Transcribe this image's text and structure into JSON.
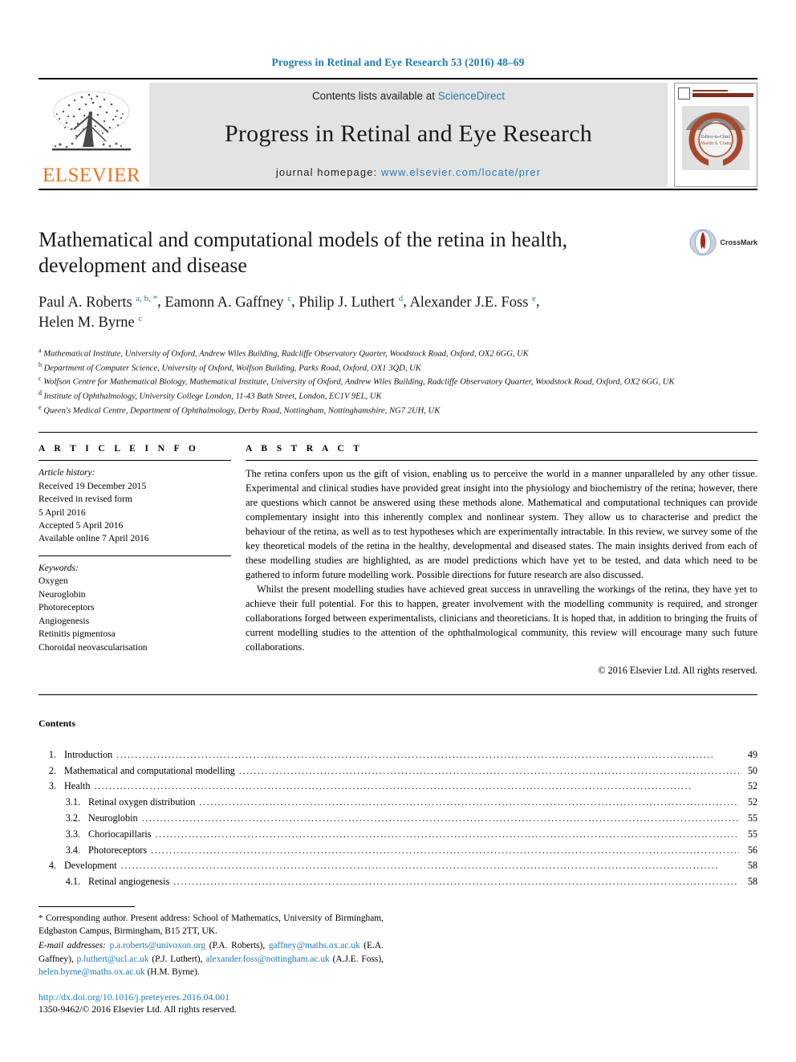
{
  "running_head": "Progress in Retinal and Eye Research 53 (2016) 48–69",
  "masthead": {
    "contents_lists_prefix": "Contents lists available at ",
    "sciencedirect": "ScienceDirect",
    "journal_name": "Progress in Retinal and Eye Research",
    "homepage_prefix": "journal homepage: ",
    "homepage_url": "www.elsevier.com/locate/prer",
    "publisher": "ELSEVIER",
    "publisher_logo_icon": "elsevier-tree-icon",
    "cover_thumb_icon": "journal-cover-eye-icon",
    "cover_title": "PROGRESS IN RETINAL AND EYE RESEARCH",
    "cover_editor_line1": "Editor-in-Chief",
    "cover_editor_line2": "Martin S. Cranz"
  },
  "article": {
    "title": "Mathematical and computational models of the retina in health, development and disease",
    "crossmark_label": "CrossMark",
    "crossmark_icon": "crossmark-icon",
    "authors": [
      {
        "name": "Paul A. Roberts",
        "sup": "a, b, *"
      },
      {
        "name": "Eamonn A. Gaffney",
        "sup": "c"
      },
      {
        "name": "Philip J. Luthert",
        "sup": "d"
      },
      {
        "name": "Alexander J.E. Foss",
        "sup": "e"
      },
      {
        "name": "Helen M. Byrne",
        "sup": "c"
      }
    ],
    "affiliations": [
      {
        "marker": "a",
        "text": "Mathematical Institute, University of Oxford, Andrew Wiles Building, Radcliffe Observatory Quarter, Woodstock Road, Oxford, OX2 6GG, UK"
      },
      {
        "marker": "b",
        "text": "Department of Computer Science, University of Oxford, Wolfson Building, Parks Road, Oxford, OX1 3QD, UK"
      },
      {
        "marker": "c",
        "text": "Wolfson Centre for Mathematical Biology, Mathematical Institute, University of Oxford, Andrew Wiles Building, Radcliffe Observatory Quarter, Woodstock Road, Oxford, OX2 6GG, UK"
      },
      {
        "marker": "d",
        "text": "Institute of Ophthalmology, University College London, 11-43 Bath Street, London, EC1V 9EL, UK"
      },
      {
        "marker": "e",
        "text": "Queen's Medical Centre, Department of Ophthalmology, Derby Road, Nottingham, Nottinghamshire, NG7 2UH, UK"
      }
    ]
  },
  "article_info": {
    "heading": "A R T I C L E  I N F O",
    "history_label": "Article history:",
    "history": [
      "Received 19 December 2015",
      "Received in revised form",
      "5 April 2016",
      "Accepted 5 April 2016",
      "Available online 7 April 2016"
    ],
    "keywords_label": "Keywords:",
    "keywords": [
      "Oxygen",
      "Neuroglobin",
      "Photoreceptors",
      "Angiogenesis",
      "Retinitis pigmentosa",
      "Choroidal neovascularisation"
    ]
  },
  "abstract": {
    "heading": "A B S T R A C T",
    "paragraph1": "The retina confers upon us the gift of vision, enabling us to perceive the world in a manner unparalleled by any other tissue. Experimental and clinical studies have provided great insight into the physiology and biochemistry of the retina; however, there are questions which cannot be answered using these methods alone. Mathematical and computational techniques can provide complementary insight into this inherently complex and nonlinear system. They allow us to characterise and predict the behaviour of the retina, as well as to test hypotheses which are experimentally intractable. In this review, we survey some of the key theoretical models of the retina in the healthy, developmental and diseased states. The main insights derived from each of these modelling studies are highlighted, as are model predictions which have yet to be tested, and data which need to be gathered to inform future modelling work. Possible directions for future research are also discussed.",
    "paragraph2": "Whilst the present modelling studies have achieved great success in unravelling the workings of the retina, they have yet to achieve their full potential. For this to happen, greater involvement with the modelling community is required, and stronger collaborations forged between experimentalists, clinicians and theoreticians. It is hoped that, in addition to bringing the fruits of current modelling studies to the attention of the ophthalmological community, this review will encourage many such future collaborations.",
    "copyright": "© 2016 Elsevier Ltd. All rights reserved."
  },
  "contents": {
    "heading": "Contents",
    "entries": [
      {
        "number": "1.",
        "label": "Introduction",
        "page": "49",
        "level": 1
      },
      {
        "number": "2.",
        "label": "Mathematical and computational modelling",
        "page": "50",
        "level": 1
      },
      {
        "number": "3.",
        "label": "Health",
        "page": "52",
        "level": 1
      },
      {
        "number": "3.1.",
        "label": "Retinal oxygen distribution",
        "page": "52",
        "level": 2
      },
      {
        "number": "3.2.",
        "label": "Neuroglobin",
        "page": "55",
        "level": 2
      },
      {
        "number": "3.3.",
        "label": "Choriocapillaris",
        "page": "55",
        "level": 2
      },
      {
        "number": "3.4.",
        "label": "Photoreceptors",
        "page": "56",
        "level": 2
      },
      {
        "number": "4.",
        "label": "Development",
        "page": "58",
        "level": 1
      },
      {
        "number": "4.1.",
        "label": "Retinal angiogenesis",
        "page": "58",
        "level": 2
      }
    ]
  },
  "footnotes": {
    "corresponding_marker": "*",
    "corresponding_text": "Corresponding author. Present address: School of Mathematics, University of Birmingham, Edgbaston Campus, Birmingham, B15 2TT, UK.",
    "email_label": "E-mail addresses:",
    "emails": [
      {
        "address": "p.a.roberts@univoxon.org",
        "owner": "(P.A. Roberts),"
      },
      {
        "address": "gaffney@maths.ox.ac.uk",
        "owner": "(E.A. Gaffney),"
      },
      {
        "address": "p.luthert@ucl.ac.uk",
        "owner": "(P.J. Luthert),"
      },
      {
        "address": "alexander.foss@nottingham.ac.uk",
        "owner": "(A.J.E. Foss),"
      },
      {
        "address": "helen.byrne@maths.ox.ac.uk",
        "owner": "(H.M. Byrne)."
      }
    ],
    "doi": "http://dx.doi.org/10.1016/j.preteyeres.2016.04.001",
    "issn_line": "1350-9462/© 2016 Elsevier Ltd. All rights reserved."
  },
  "colors": {
    "link_blue": "#1f7ab4",
    "sciencedirect_blue": "#2a7ab0",
    "elsevier_orange": "#E87722",
    "masthead_gray": "#e3e3e3",
    "cover_rust": "#a8492c"
  }
}
